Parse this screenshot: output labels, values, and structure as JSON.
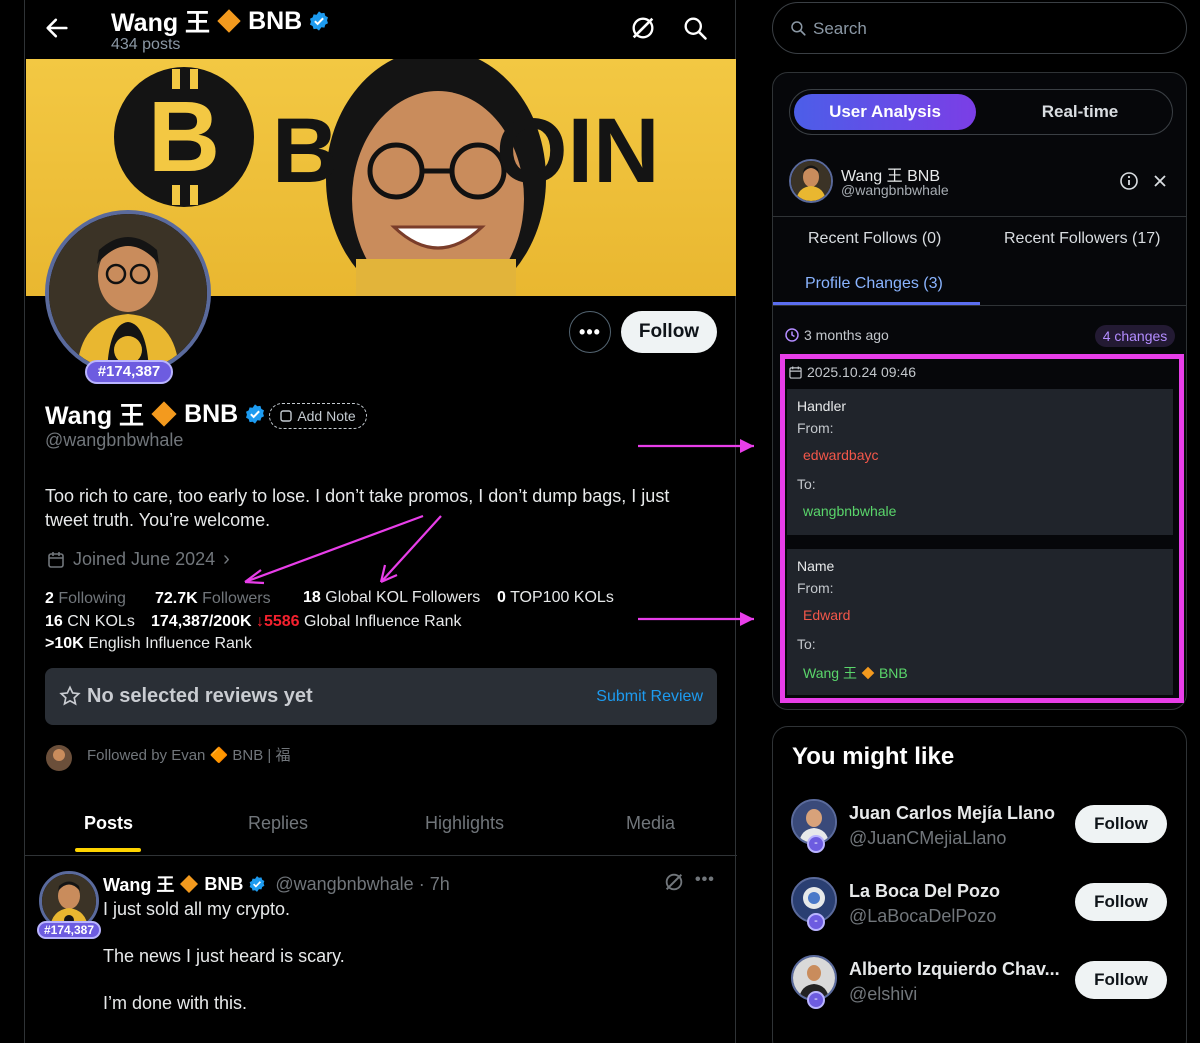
{
  "profile": {
    "name_prefix": "Wang 王",
    "name_suffix": "BNB",
    "posts_count": "434 posts",
    "handle": "@wangbnbwhale",
    "rank": "#174,387",
    "add_note": "Add Note",
    "follow_label": "Follow",
    "bio": "Too rich to care, too early to lose. I don’t take promos, I don’t dump bags, I just tweet truth. You’re welcome.",
    "joined": "Joined June 2024",
    "banner_text_left": "B",
    "banner_text_right": "OIN"
  },
  "stats": {
    "following_num": "2",
    "following_label": "Following",
    "followers_num": "72.7K",
    "followers_label": "Followers",
    "global_kol_num": "18",
    "global_kol_label": "Global KOL Followers",
    "top100_num": "0",
    "top100_label": "TOP100 KOLs",
    "cn_kols_num": "16",
    "cn_kols_label": "CN KOLs",
    "influence_num": "174,387/200K",
    "influence_change": "5586",
    "influence_label": "Global Influence Rank",
    "english_num": ">10K",
    "english_label": "English Influence Rank"
  },
  "reviews": {
    "empty_text": "No selected reviews yet",
    "submit_label": "Submit Review"
  },
  "followed_by": "Followed by Evan 🔶 BNB | 福",
  "tabs": [
    "Posts",
    "Replies",
    "Highlights",
    "Media"
  ],
  "post": {
    "handle_time": "@wangbnbwhale · 7h",
    "rank": "#174,387",
    "lines": [
      "I just sold all my crypto.",
      "The news I just heard is scary.",
      "I’m done with this."
    ]
  },
  "search": {
    "placeholder": "Search"
  },
  "panel": {
    "seg_active": "User Analysis",
    "seg_other": "Real-time",
    "user_name": "Wang 王 BNB",
    "user_handle": "@wangbnbwhale",
    "tab_follows": "Recent Follows (0)",
    "tab_followers": "Recent Followers (17)",
    "tab_changes": "Profile Changes (3)",
    "ago": "3 months ago",
    "changes_count": "4 changes",
    "date": "2025.10.24 09:46",
    "from_label": "From:",
    "to_label": "To:",
    "handler": {
      "label": "Handler",
      "from": "edwardbayc",
      "to": "wangbnbwhale"
    },
    "name": {
      "label": "Name",
      "from": "Edward",
      "to_prefix": "Wang 王",
      "to_suffix": "BNB"
    }
  },
  "might_like": {
    "title": "You might like",
    "follow_label": "Follow",
    "items": [
      {
        "name": "Juan Carlos Mejía Llano",
        "handle": "@JuanCMejiaLlano"
      },
      {
        "name": "La Boca Del Pozo",
        "handle": "@LaBocaDelPozo"
      },
      {
        "name": "Alberto Izquierdo Chav...",
        "handle": "@elshivi"
      }
    ]
  },
  "colors": {
    "accent_blue": "#1d9bf0",
    "highlight_magenta": "#e83ee9",
    "banner_yellow": "#f3c843",
    "from_red": "#f4574a",
    "to_green": "#5ad66b"
  }
}
